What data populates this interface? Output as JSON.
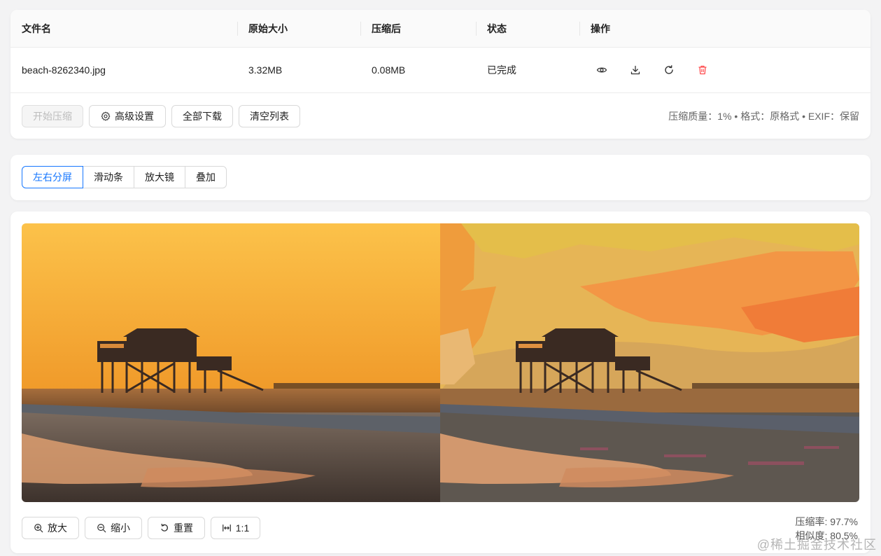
{
  "table": {
    "headers": {
      "filename": "文件名",
      "original_size": "原始大小",
      "compressed": "压缩后",
      "status": "状态",
      "actions": "操作"
    },
    "rows": [
      {
        "filename": "beach-8262340.jpg",
        "original_size": "3.32MB",
        "compressed": "0.08MB",
        "status": "已完成",
        "actions": [
          "eye-icon",
          "download-icon",
          "refresh-icon",
          "delete-icon"
        ]
      }
    ]
  },
  "toolbar": {
    "start_label": "开始压缩",
    "advanced_label": "高级设置",
    "download_all_label": "全部下载",
    "clear_label": "清空列表",
    "settings_summary": "压缩质量：1% • 格式：原格式 • EXIF：保留"
  },
  "modes": {
    "items": [
      "左右分屏",
      "滑动条",
      "放大镜",
      "叠加"
    ],
    "active": "左右分屏"
  },
  "viewer": {
    "zoom_in_label": "放大",
    "zoom_out_label": "缩小",
    "reset_label": "重置",
    "actual_size_label": "1:1",
    "compression_rate": "压缩率: 97.7%",
    "similarity": "相似度: 80.5%"
  },
  "watermark": "@稀土掘金技术社区",
  "colors": {
    "accent": "#1677ff",
    "danger": "#ff4d4f",
    "sky_top": "#fcc24a",
    "sky_bottom": "#f3a22c"
  }
}
